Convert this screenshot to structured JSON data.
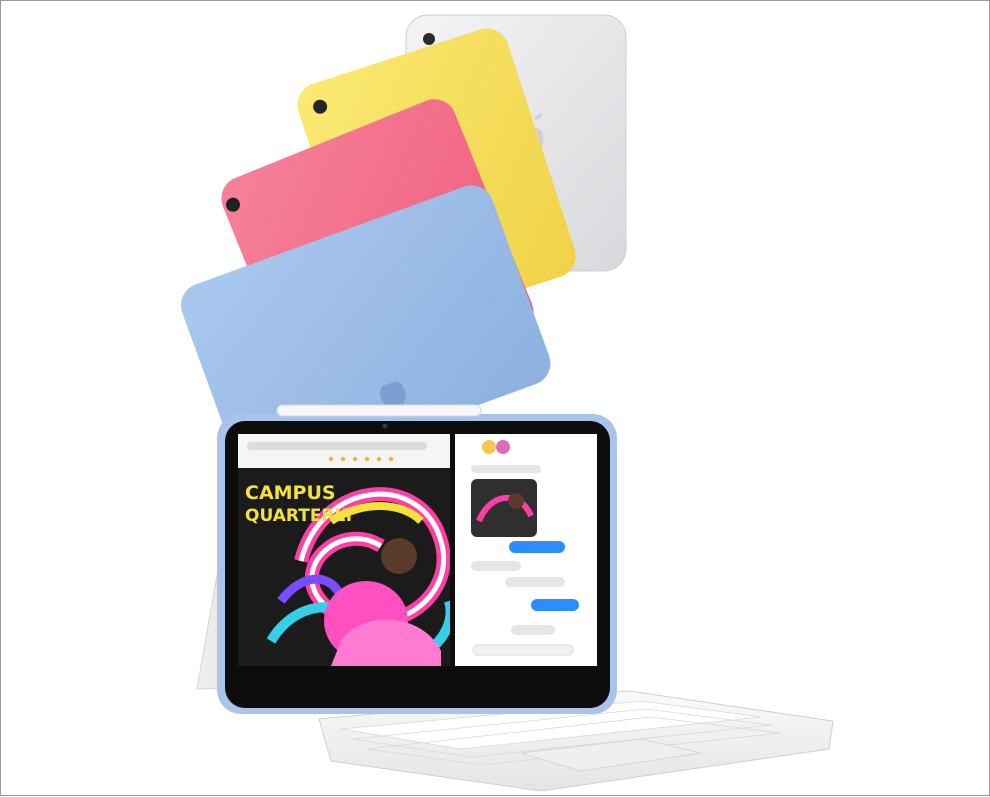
{
  "image": {
    "subject": "Apple iPad lineup with Magic Keyboard Folio",
    "colors": {
      "silver": "#e9e9ec",
      "yellow": "#f7e15a",
      "pink": "#f5708a",
      "blue": "#9ebee8",
      "keyboard": "#f3f3f3",
      "screen_bg": "#1b1b1b"
    }
  },
  "screen": {
    "poster_line1": "CAMPUS",
    "poster_line2": "QUARTERLY"
  }
}
